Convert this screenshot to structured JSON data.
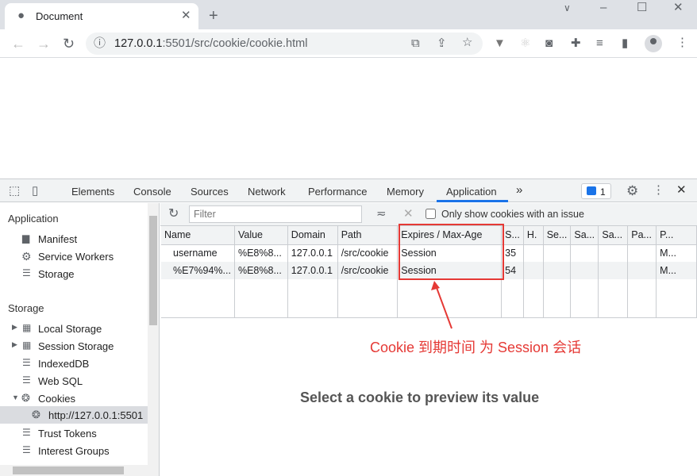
{
  "browser": {
    "tab_title": "Document",
    "url_host": "127.0.0.1",
    "url_rest": ":5501/src/cookie/cookie.html"
  },
  "devtools": {
    "tabs": [
      "Elements",
      "Console",
      "Sources",
      "Network",
      "Performance",
      "Memory",
      "Application"
    ],
    "active_tab": "Application",
    "issues_count": "1",
    "accent_color": "#1a73e8"
  },
  "sidebar": {
    "application_header": "Application",
    "app_items": [
      "Manifest",
      "Service Workers",
      "Storage"
    ],
    "storage_header": "Storage",
    "storage_items": [
      "Local Storage",
      "Session Storage",
      "IndexedDB",
      "Web SQL",
      "Cookies"
    ],
    "cookie_origin": "http://127.0.0.1:5501",
    "more_items": [
      "Trust Tokens",
      "Interest Groups"
    ]
  },
  "toolbar": {
    "filter_placeholder": "Filter",
    "only_issues_label": "Only show cookies with an issue"
  },
  "table": {
    "columns": [
      "Name",
      "Value",
      "Domain",
      "Path",
      "Expires / Max-Age",
      "S...",
      "H.",
      "Se...",
      "Sa...",
      "Sa...",
      "Pa...",
      "P..."
    ],
    "rows": [
      [
        "username",
        "%E8%8...",
        "127.0.0.1",
        "/src/cookie",
        "Session",
        "35",
        "",
        "",
        "",
        "",
        "",
        "M..."
      ],
      [
        "%E7%94%...",
        "%E8%8...",
        "127.0.0.1",
        "/src/cookie",
        "Session",
        "54",
        "",
        "",
        "",
        "",
        "",
        "M..."
      ]
    ]
  },
  "preview_text": "Select a cookie to preview its value",
  "annotation": {
    "text": "Cookie 到期时间 为 Session 会话",
    "color": "#e53935"
  }
}
